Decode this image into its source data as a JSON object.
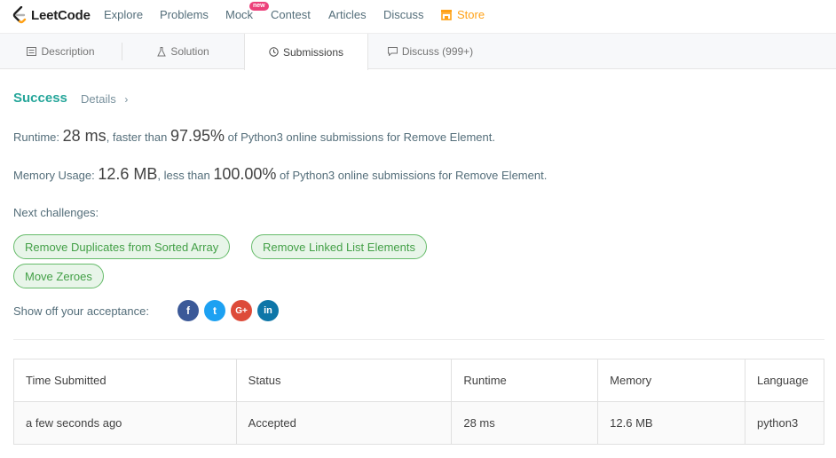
{
  "brand": {
    "name": "LeetCode",
    "logo_icon": "leetcode-logo-icon",
    "logo_colors": [
      "#ffa116",
      "#212121",
      "#b3b3b3"
    ]
  },
  "nav": {
    "explore": "Explore",
    "problems": "Problems",
    "mock": "Mock",
    "mock_badge": "new",
    "contest": "Contest",
    "articles": "Articles",
    "discuss": "Discuss",
    "store": "Store",
    "store_icon": "store-icon"
  },
  "tabs": {
    "description": "Description",
    "solution": "Solution",
    "submissions": "Submissions",
    "discuss": "Discuss (999+)",
    "active": "submissions"
  },
  "result": {
    "status": "Success",
    "details": "Details",
    "runtime_label": "Runtime:",
    "runtime_value": "28 ms",
    "runtime_mid": ", faster than",
    "runtime_pct": "97.95%",
    "runtime_tail": "of Python3 online submissions for Remove Element.",
    "memory_label": "Memory Usage:",
    "memory_value": "12.6 MB",
    "memory_mid": ", less than",
    "memory_pct": "100.00%",
    "memory_tail": "of Python3 online submissions for Remove Element."
  },
  "challenges": {
    "label": "Next challenges:",
    "items": [
      "Remove Duplicates from Sorted Array",
      "Remove Linked List Elements",
      "Move Zeroes"
    ]
  },
  "share": {
    "label": "Show off your acceptance:",
    "icons": [
      {
        "name": "facebook-icon",
        "glyph": "f",
        "color": "#3b5998"
      },
      {
        "name": "twitter-icon",
        "glyph": "t",
        "color": "#1da1f2"
      },
      {
        "name": "google-plus-icon",
        "glyph": "G+",
        "color": "#dd4b39"
      },
      {
        "name": "linkedin-icon",
        "glyph": "in",
        "color": "#0e76a8"
      }
    ]
  },
  "submissions_table": {
    "headers": [
      "Time Submitted",
      "Status",
      "Runtime",
      "Memory",
      "Language"
    ],
    "rows": [
      [
        "a few seconds ago",
        "Accepted",
        "28 ms",
        "12.6 MB",
        "python3"
      ]
    ]
  },
  "colors": {
    "accent": "#26a69a",
    "chip_bg": "#e8f5e9",
    "chip_text": "#43a047",
    "store": "#ffa116"
  }
}
